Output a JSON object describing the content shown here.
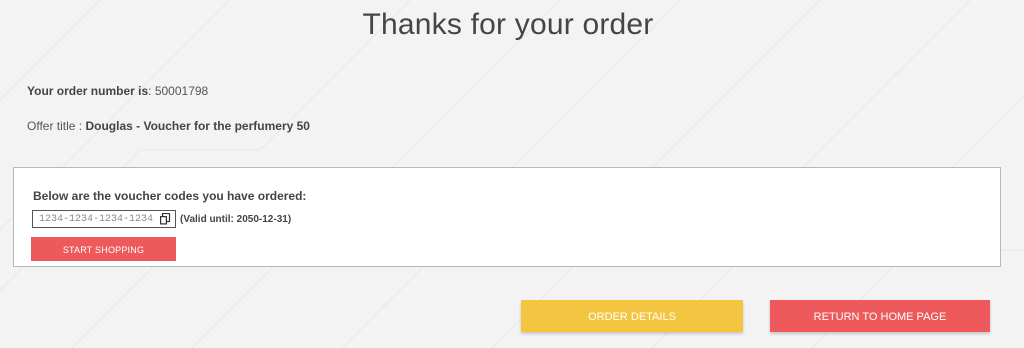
{
  "page": {
    "title": "Thanks for your order"
  },
  "order": {
    "number_label": "Your order number is",
    "number_sep": ":",
    "number_value": "50001798",
    "offer_label": "Offer title :",
    "offer_value": "Douglas - Voucher for the perfumery 50"
  },
  "voucher": {
    "heading": "Below are the voucher codes you have ordered:",
    "code": "1234-1234-1234-1234",
    "copy_icon": "copy-icon",
    "valid_text": "(Valid until: 2050-12-31)",
    "start_shopping_label": "START SHOPPING"
  },
  "actions": {
    "order_details_label": "ORDER DETAILS",
    "return_home_label": "RETURN TO HOME PAGE"
  },
  "colors": {
    "background": "#f3f3f3",
    "primary_red": "#ee5a5c",
    "accent_yellow": "#f4c540"
  }
}
